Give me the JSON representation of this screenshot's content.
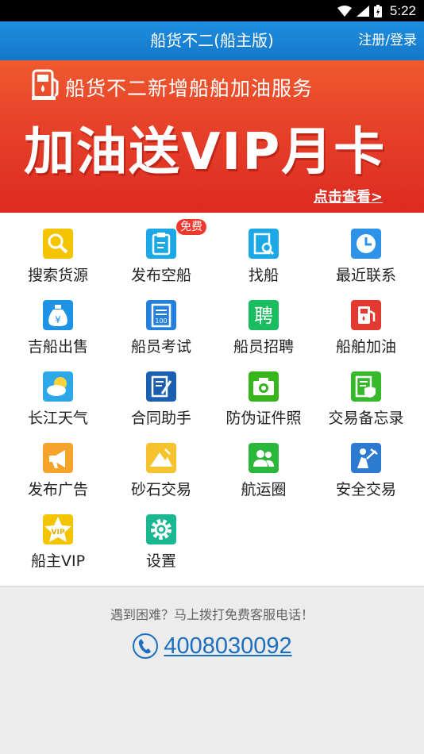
{
  "status_bar": {
    "time": "5:22"
  },
  "header": {
    "title": "船货不二(船主版)",
    "login": "注册/登录"
  },
  "banner": {
    "subline": "船货不二新增船舶加油服务",
    "headline": "加油送VIP月卡",
    "more": "点击查看>"
  },
  "grid": {
    "items": [
      {
        "label": "搜索货源",
        "icon": "search-icon",
        "color": "#f5c400"
      },
      {
        "label": "发布空船",
        "icon": "clipboard-icon",
        "color": "#1ca7e6",
        "badge": "免费"
      },
      {
        "label": "找船",
        "icon": "document-search-icon",
        "color": "#1ca7e6"
      },
      {
        "label": "最近联系",
        "icon": "clock-icon",
        "color": "#2c93e8"
      },
      {
        "label": "吉船出售",
        "icon": "money-bag-icon",
        "color": "#1e93e6"
      },
      {
        "label": "船员考试",
        "icon": "exam-paper-icon",
        "color": "#2380de"
      },
      {
        "label": "船员招聘",
        "icon": "recruit-icon",
        "color": "#19bd5f"
      },
      {
        "label": "船舶加油",
        "icon": "fuel-pump-icon",
        "color": "#e23a30"
      },
      {
        "label": "长江天气",
        "icon": "weather-icon",
        "color": "#2ca7e8"
      },
      {
        "label": "合同助手",
        "icon": "contract-icon",
        "color": "#1a5fb0"
      },
      {
        "label": "防伪证件照",
        "icon": "camera-icon",
        "color": "#37b51c"
      },
      {
        "label": "交易备忘录",
        "icon": "memo-shield-icon",
        "color": "#35b92a"
      },
      {
        "label": "发布广告",
        "icon": "megaphone-icon",
        "color": "#f5a32a"
      },
      {
        "label": "砂石交易",
        "icon": "sand-icon",
        "color": "#f6c22e"
      },
      {
        "label": "航运圈",
        "icon": "contacts-icon",
        "color": "#2ab73a"
      },
      {
        "label": "安全交易",
        "icon": "safe-trade-icon",
        "color": "#2c7bd0"
      },
      {
        "label": "船主VIP",
        "icon": "vip-star-icon",
        "color": "#f5c400"
      },
      {
        "label": "设置",
        "icon": "gear-icon",
        "color": "#19b890"
      }
    ]
  },
  "footer": {
    "hint": "遇到困难？马上拨打免费客服电话！",
    "phone": "4008030092"
  }
}
